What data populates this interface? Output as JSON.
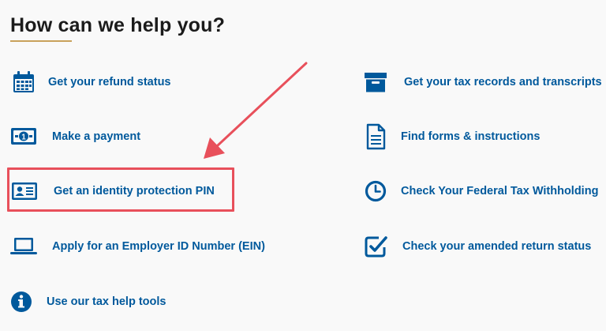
{
  "heading": "How can we help you?",
  "colors": {
    "link": "#00599c",
    "icon": "#00599c",
    "highlight": "#e8505b",
    "accent_underline": "#c9a25b"
  },
  "left_column": [
    {
      "label": "Get your refund status",
      "icon": "calendar-icon"
    },
    {
      "label": "Make a payment",
      "icon": "dollar-bill-icon"
    },
    {
      "label": "Get an identity protection PIN",
      "icon": "id-card-icon"
    },
    {
      "label": "Apply for an Employer ID Number (EIN)",
      "icon": "laptop-icon"
    },
    {
      "label": "Use our tax help tools",
      "icon": "info-icon"
    }
  ],
  "right_column": [
    {
      "label": "Get your tax records and transcripts",
      "icon": "archive-box-icon"
    },
    {
      "label": "Find forms & instructions",
      "icon": "document-icon"
    },
    {
      "label": "Check Your Federal Tax Withholding",
      "icon": "clock-icon"
    },
    {
      "label": "Check your amended return status",
      "icon": "checkbox-icon"
    }
  ]
}
